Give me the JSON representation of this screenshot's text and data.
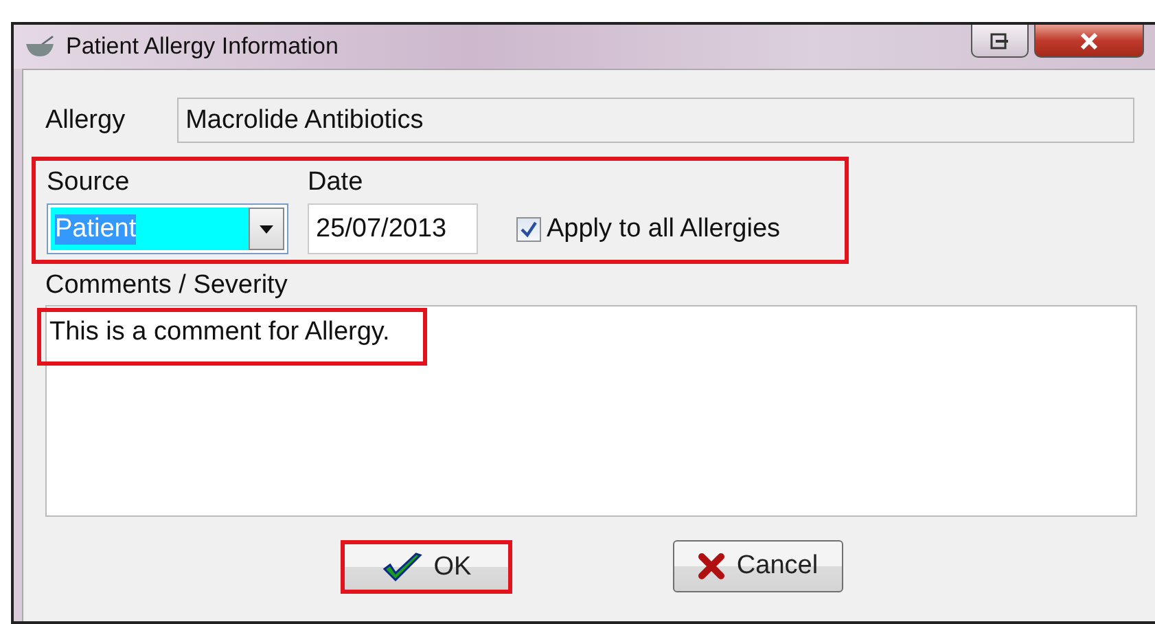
{
  "window": {
    "title": "Patient Allergy Information"
  },
  "allergy": {
    "label": "Allergy",
    "value": "Macrolide Antibiotics"
  },
  "source": {
    "label": "Source",
    "value": "Patient",
    "selected": true
  },
  "date": {
    "label": "Date",
    "value": "25/07/2013"
  },
  "apply_all": {
    "label": "Apply to all Allergies",
    "checked": true
  },
  "comments": {
    "label": "Comments / Severity",
    "value": "This is a comment for Allergy."
  },
  "buttons": [
    {
      "kind": "ok",
      "label": "OK"
    },
    {
      "kind": "cancel",
      "label": "Cancel"
    }
  ]
}
